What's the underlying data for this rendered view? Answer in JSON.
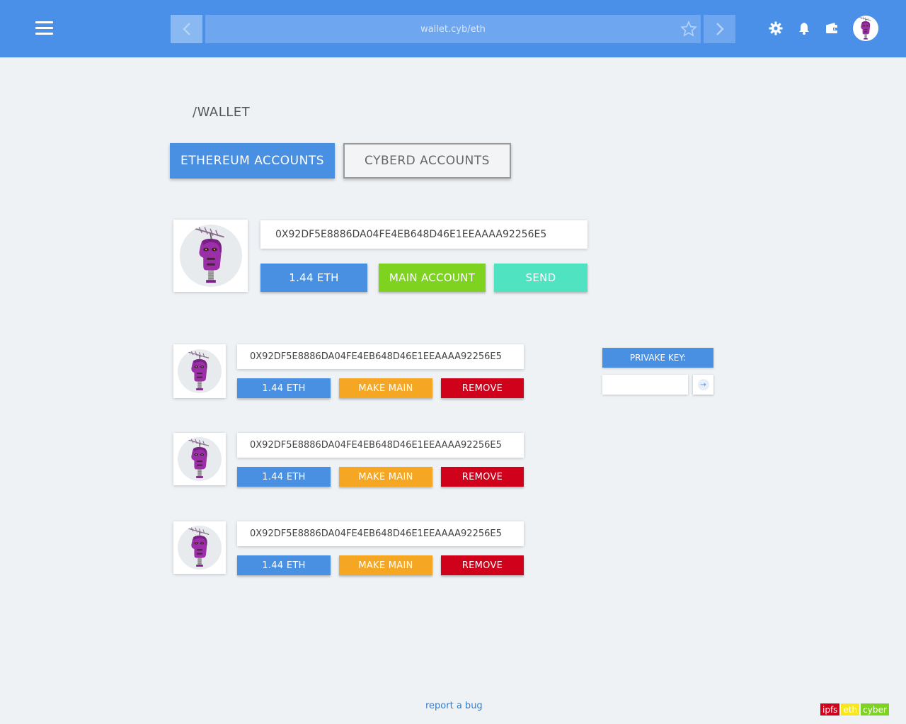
{
  "header": {
    "address": "wallet.cyb/eth",
    "colors": {
      "bar": "#4a90e9",
      "accent": "#6ea7ef"
    },
    "icons": [
      "menu-icon",
      "back-arrow-icon",
      "star-icon",
      "forward-arrow-icon",
      "gear-icon",
      "bell-icon",
      "wallet-icon",
      "avatar"
    ]
  },
  "page": {
    "title": "/WALLET"
  },
  "tabs": [
    {
      "label": "ETHEREUM ACCOUNTS",
      "active": true
    },
    {
      "label": "CYBERD ACCOUNTS",
      "active": false
    }
  ],
  "main_account": {
    "address": "0X92DF5E8886DA04FE4EB648D46E1EEAAAA92256E5",
    "balance": "1.44 ETH",
    "main_label": "MAIN ACCOUNT",
    "send_label": "SEND"
  },
  "accounts": [
    {
      "address": "0X92DF5E8886DA04FE4EB648D46E1EEAAAA92256E5",
      "balance": "1.44 ETH",
      "make_main": "MAKE MAIN",
      "remove": "REMOVE"
    },
    {
      "address": "0X92DF5E8886DA04FE4EB648D46E1EEAAAA92256E5",
      "balance": "1.44 ETH",
      "make_main": "MAKE MAIN",
      "remove": "REMOVE"
    },
    {
      "address": "0X92DF5E8886DA04FE4EB648D46E1EEAAAA92256E5",
      "balance": "1.44 ETH",
      "make_main": "MAKE MAIN",
      "remove": "REMOVE"
    }
  ],
  "private_key": {
    "label": "PRIVAKE KEY:",
    "value": ""
  },
  "footer": {
    "report": "report a bug",
    "badges": [
      "ipfs",
      "eth",
      "cyber"
    ]
  }
}
